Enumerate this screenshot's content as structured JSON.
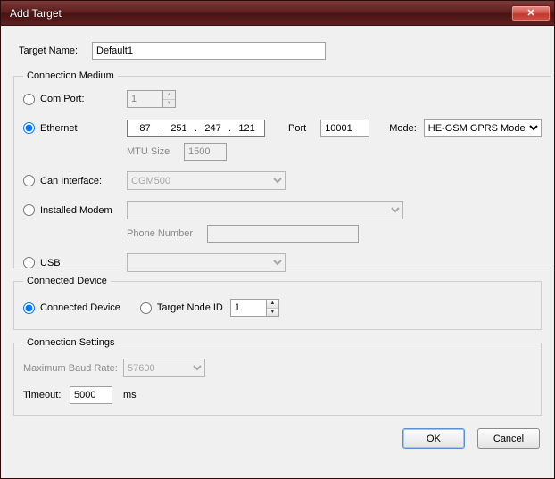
{
  "window": {
    "title": "Add Target"
  },
  "targetName": {
    "label": "Target Name:",
    "value": "Default1"
  },
  "connectionMedium": {
    "legend": "Connection Medium",
    "comPort": {
      "label": "Com Port:",
      "value": "1"
    },
    "ethernet": {
      "label": "Ethernet",
      "ip": [
        "87",
        "251",
        "247",
        "121"
      ],
      "portLabel": "Port",
      "portValue": "10001",
      "modeLabel": "Mode:",
      "modeValue": "HE-GSM GPRS Mode",
      "mtuLabel": "MTU Size",
      "mtuValue": "1500"
    },
    "canInterface": {
      "label": "Can Interface:",
      "value": "CGM500"
    },
    "installedModem": {
      "label": "Installed Modem",
      "value": "",
      "phoneLabel": "Phone Number",
      "phoneValue": ""
    },
    "usb": {
      "label": "USB",
      "value": ""
    }
  },
  "connectedDevice": {
    "legend": "Connected Device",
    "connectedLabel": "Connected Device",
    "targetNodeLabel": "Target Node ID",
    "targetNodeValue": "1"
  },
  "connectionSettings": {
    "legend": "Connection Settings",
    "baudLabel": "Maximum Baud Rate:",
    "baudValue": "57600",
    "timeoutLabel": "Timeout:",
    "timeoutValue": "5000",
    "timeoutUnit": "ms"
  },
  "buttons": {
    "ok": "OK",
    "cancel": "Cancel"
  }
}
